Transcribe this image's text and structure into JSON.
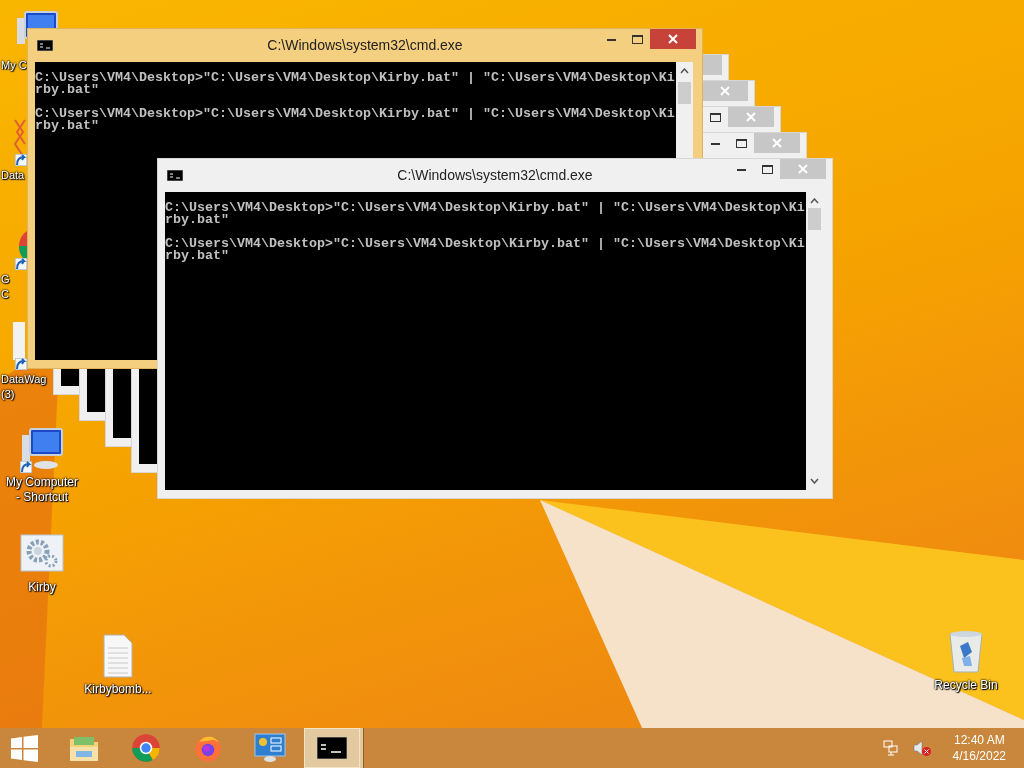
{
  "desktop_icons": [
    {
      "kind": "computer",
      "label": "My C",
      "shortcut": false
    },
    {
      "kind": "network",
      "label": "Data",
      "shortcut": true
    },
    {
      "kind": "chrome",
      "label": "G\nC",
      "shortcut": true
    },
    {
      "kind": "blank",
      "label": "DataWag\n(3)",
      "shortcut": true
    },
    {
      "kind": "computer",
      "label": "My Computer\n- Shortcut",
      "shortcut": true
    },
    {
      "kind": "settings",
      "label": "Kirby",
      "shortcut": false
    },
    {
      "kind": "file",
      "label": "Kirbybomb...",
      "shortcut": false
    },
    {
      "kind": "recycle",
      "label": "Recycle Bin",
      "shortcut": false
    }
  ],
  "windows": [
    {
      "title": "C:\\Windows\\system32\\cmd.exe",
      "active": true,
      "blocks": [
        [
          "C:\\Users\\VM4\\Desktop>\"C:\\Users\\VM4\\Desktop\\Kirby.bat\" | \"C:\\Users\\VM4\\Desktop\\Ki",
          "rby.bat\""
        ],
        [
          "C:\\Users\\VM4\\Desktop>\"C:\\Users\\VM4\\Desktop\\Kirby.bat\" | \"C:\\Users\\VM4\\Desktop\\Ki",
          "rby.bat\""
        ]
      ]
    },
    {
      "active": false
    },
    {
      "active": false
    },
    {
      "active": false
    },
    {
      "active": false
    },
    {
      "title": "C:\\Windows\\system32\\cmd.exe",
      "active": false,
      "blocks": [
        [
          "C:\\Users\\VM4\\Desktop>\"C:\\Users\\VM4\\Desktop\\Kirby.bat\" | \"C:\\Users\\VM4\\Desktop\\Ki",
          "rby.bat\""
        ],
        [
          "C:\\Users\\VM4\\Desktop>\"C:\\Users\\VM4\\Desktop\\Kirby.bat\" | \"C:\\Users\\VM4\\Desktop\\Ki",
          "rby.bat\""
        ]
      ]
    }
  ],
  "taskbar": {
    "apps": [
      {
        "kind": "explorer",
        "selected": false
      },
      {
        "kind": "chrome",
        "selected": false
      },
      {
        "kind": "firefox",
        "selected": false
      },
      {
        "kind": "control",
        "selected": false
      },
      {
        "kind": "cmd",
        "selected": true
      }
    ],
    "tray": {
      "volume_muted": true,
      "time": "12:40 AM",
      "date": "4/16/2022"
    }
  }
}
